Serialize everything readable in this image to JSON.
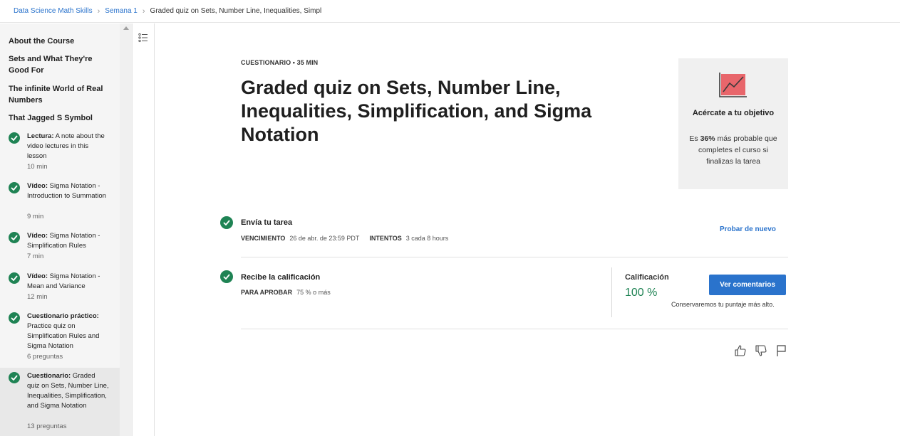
{
  "breadcrumb": {
    "course": "Data Science Math Skills",
    "week": "Semana 1",
    "current": "Graded quiz on Sets, Number Line, Inequalities, Simpl"
  },
  "sidebar": {
    "sections": [
      "About the Course",
      "Sets and What They're Good For",
      "The infinite World of Real Numbers",
      "That Jagged S Symbol"
    ],
    "items": [
      {
        "type": "Lectura:",
        "text": " A note about the video lectures in this lesson",
        "meta": "10 min"
      },
      {
        "type": "Vídeo:",
        "text": " Sigma Notation - Introduction to Summation",
        "meta": "9 min"
      },
      {
        "type": "Vídeo:",
        "text": " Sigma Notation - Simplification Rules",
        "meta": "7 min"
      },
      {
        "type": "Vídeo:",
        "text": " Sigma Notation - Mean and Variance",
        "meta": "12 min"
      },
      {
        "type": "Cuestionario práctico:",
        "text": " Practice quiz on Simplification Rules and Sigma Notation",
        "meta": "6 preguntas"
      },
      {
        "type": "Cuestionario:",
        "text": " Graded quiz on Sets, Number Line, Inequalities, Simplification, and Sigma Notation",
        "meta": "13 preguntas"
      }
    ]
  },
  "main": {
    "eyebrow": "CUESTIONARIO • 35 MIN",
    "title": "Graded quiz on Sets, Number Line, Inequalities, Simplification, and Sigma Notation"
  },
  "goal": {
    "title": "Acércate a tu objetivo",
    "desc_pre": "Es ",
    "desc_bold": "36%",
    "desc_post": " más probable que completes el curso si finalizas la tarea",
    "icon": "chart-trend-icon",
    "accent": "#e8666b"
  },
  "submit": {
    "title": "Envía tu tarea",
    "due_label": "VENCIMIENTO",
    "due_value": "26 de abr. de 23:59 PDT",
    "attempts_label": "INTENTOS",
    "attempts_value": "3 cada 8 hours",
    "retry": "Probar de nuevo"
  },
  "grade": {
    "title": "Recibe la calificación",
    "pass_label": "PARA APROBAR",
    "pass_value": "75 % o más",
    "label": "Calificación",
    "value": "100 %",
    "button": "Ver comentarios",
    "note": "Conservaremos tu puntaje más alto."
  },
  "colors": {
    "link": "#2a73cc",
    "success": "#1f8354",
    "primary": "#2a73cc"
  }
}
